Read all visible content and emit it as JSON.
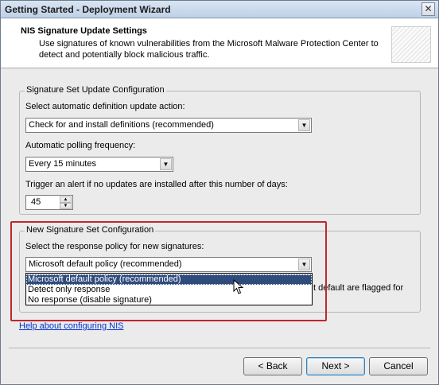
{
  "window": {
    "title": "Getting Started - Deployment Wizard",
    "close_glyph": "✕"
  },
  "header": {
    "title": "NIS Signature Update Settings",
    "description": "Use signatures of known vulnerabilities from the Microsoft Malware Protection Center to detect and potentially block malicious traffic."
  },
  "signature_set_update": {
    "legend": "Signature Set Update Configuration",
    "action_label": "Select automatic definition update action:",
    "action_value": "Check for and install definitions (recommended)",
    "polling_label": "Automatic polling frequency:",
    "polling_value": "Every 15 minutes",
    "alert_label": "Trigger an alert if no updates are installed after this number of days:",
    "alert_days": "45"
  },
  "new_signature_set": {
    "legend": "New Signature Set Configuration",
    "policy_label": "Select the response policy for new signatures:",
    "policy_value": "Microsoft default policy (recommended)",
    "policy_options": [
      "Microsoft default policy (recommended)",
      "Detect only response",
      "No response (disable signature)"
    ],
    "hidden_text_fragment": "t default are flagged for"
  },
  "help_link": "Help about configuring NIS",
  "buttons": {
    "back": "< Back",
    "next": "Next >",
    "cancel": "Cancel"
  },
  "colors": {
    "highlight_border": "#c0272d",
    "selection": "#2f4c7d",
    "link": "#0033cc"
  }
}
